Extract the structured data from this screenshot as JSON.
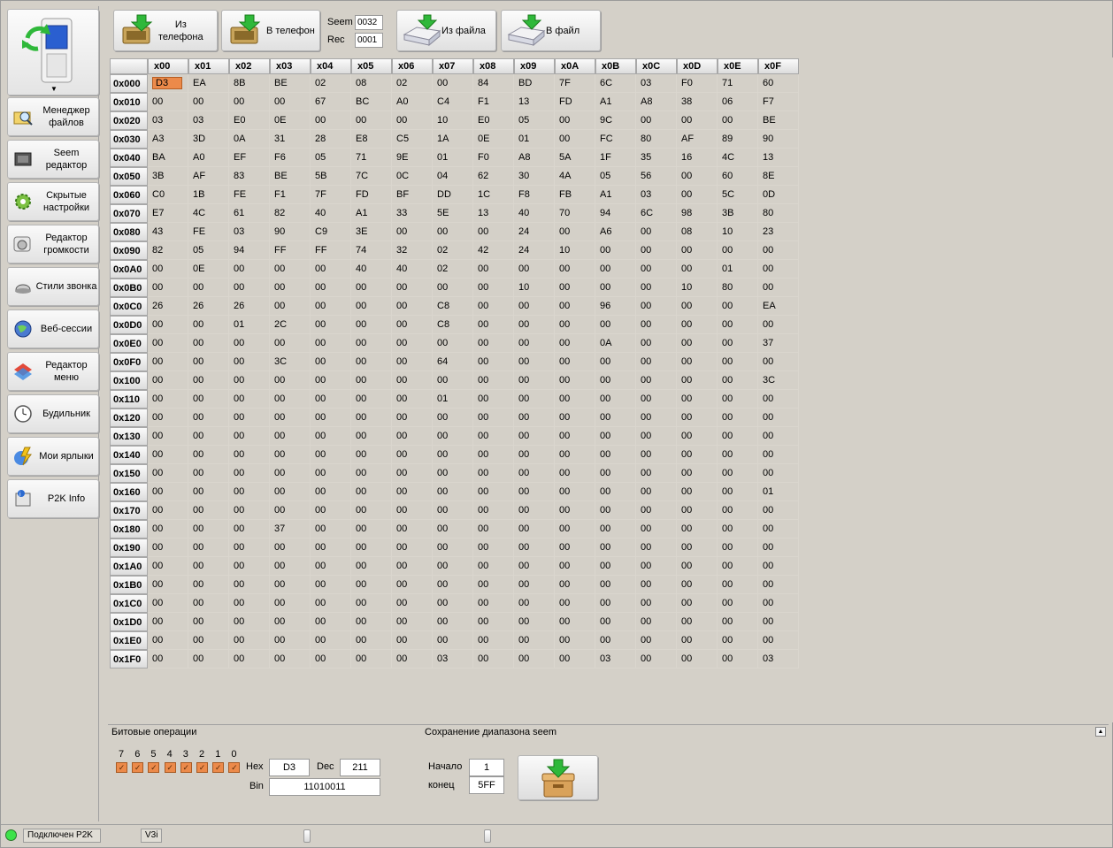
{
  "toolbar": {
    "from_phone": "Из\nтелефона",
    "to_phone": "В телефон",
    "seem_label": "Seem",
    "seem_value": "0032",
    "rec_label": "Rec",
    "rec_value": "0001",
    "from_file": "Из файла",
    "to_file": "В файл"
  },
  "sidebar": {
    "items": [
      {
        "label": "Менеджер\nфайлов",
        "icon": "folder-magnifier-icon"
      },
      {
        "label": "Seem\nредактор",
        "icon": "chip-icon"
      },
      {
        "label": "Скрытые\nнастройки",
        "icon": "gear-icon"
      },
      {
        "label": "Редактор\nгромкости",
        "icon": "speaker-icon"
      },
      {
        "label": "Стили звонка",
        "icon": "bell-icon"
      },
      {
        "label": "Веб-сессии",
        "icon": "globe-icon"
      },
      {
        "label": "Редактор\nменю",
        "icon": "menu-icon"
      },
      {
        "label": "Будильник",
        "icon": "clock-icon"
      },
      {
        "label": "Мои ярлыки",
        "icon": "shortcut-icon"
      },
      {
        "label": "P2K Info",
        "icon": "info-icon"
      }
    ]
  },
  "hex": {
    "columns": [
      "x00",
      "x01",
      "x02",
      "x03",
      "x04",
      "x05",
      "x06",
      "x07",
      "x08",
      "x09",
      "x0A",
      "x0B",
      "x0C",
      "x0D",
      "x0E",
      "x0F"
    ],
    "selected": {
      "row": 0,
      "col": 0
    },
    "rows": [
      {
        "addr": "0x000",
        "cells": [
          "D3",
          "EA",
          "8B",
          "BE",
          "02",
          "08",
          "02",
          "00",
          "84",
          "BD",
          "7F",
          "6C",
          "03",
          "F0",
          "71",
          "60"
        ]
      },
      {
        "addr": "0x010",
        "cells": [
          "00",
          "00",
          "00",
          "00",
          "67",
          "BC",
          "A0",
          "C4",
          "F1",
          "13",
          "FD",
          "A1",
          "A8",
          "38",
          "06",
          "F7"
        ]
      },
      {
        "addr": "0x020",
        "cells": [
          "03",
          "03",
          "E0",
          "0E",
          "00",
          "00",
          "00",
          "10",
          "E0",
          "05",
          "00",
          "9C",
          "00",
          "00",
          "00",
          "BE"
        ]
      },
      {
        "addr": "0x030",
        "cells": [
          "A3",
          "3D",
          "0A",
          "31",
          "28",
          "E8",
          "C5",
          "1A",
          "0E",
          "01",
          "00",
          "FC",
          "80",
          "AF",
          "89",
          "90"
        ]
      },
      {
        "addr": "0x040",
        "cells": [
          "BA",
          "A0",
          "EF",
          "F6",
          "05",
          "71",
          "9E",
          "01",
          "F0",
          "A8",
          "5A",
          "1F",
          "35",
          "16",
          "4C",
          "13"
        ]
      },
      {
        "addr": "0x050",
        "cells": [
          "3B",
          "AF",
          "83",
          "BE",
          "5B",
          "7C",
          "0C",
          "04",
          "62",
          "30",
          "4A",
          "05",
          "56",
          "00",
          "60",
          "8E"
        ]
      },
      {
        "addr": "0x060",
        "cells": [
          "C0",
          "1B",
          "FE",
          "F1",
          "7F",
          "FD",
          "BF",
          "DD",
          "1C",
          "F8",
          "FB",
          "A1",
          "03",
          "00",
          "5C",
          "0D"
        ]
      },
      {
        "addr": "0x070",
        "cells": [
          "E7",
          "4C",
          "61",
          "82",
          "40",
          "A1",
          "33",
          "5E",
          "13",
          "40",
          "70",
          "94",
          "6C",
          "98",
          "3B",
          "80"
        ]
      },
      {
        "addr": "0x080",
        "cells": [
          "43",
          "FE",
          "03",
          "90",
          "C9",
          "3E",
          "00",
          "00",
          "00",
          "24",
          "00",
          "A6",
          "00",
          "08",
          "10",
          "23"
        ]
      },
      {
        "addr": "0x090",
        "cells": [
          "82",
          "05",
          "94",
          "FF",
          "FF",
          "74",
          "32",
          "02",
          "42",
          "24",
          "10",
          "00",
          "00",
          "00",
          "00",
          "00"
        ]
      },
      {
        "addr": "0x0A0",
        "cells": [
          "00",
          "0E",
          "00",
          "00",
          "00",
          "40",
          "40",
          "02",
          "00",
          "00",
          "00",
          "00",
          "00",
          "00",
          "01",
          "00"
        ]
      },
      {
        "addr": "0x0B0",
        "cells": [
          "00",
          "00",
          "00",
          "00",
          "00",
          "00",
          "00",
          "00",
          "00",
          "10",
          "00",
          "00",
          "00",
          "10",
          "80",
          "00"
        ]
      },
      {
        "addr": "0x0C0",
        "cells": [
          "26",
          "26",
          "26",
          "00",
          "00",
          "00",
          "00",
          "C8",
          "00",
          "00",
          "00",
          "96",
          "00",
          "00",
          "00",
          "EA"
        ]
      },
      {
        "addr": "0x0D0",
        "cells": [
          "00",
          "00",
          "01",
          "2C",
          "00",
          "00",
          "00",
          "C8",
          "00",
          "00",
          "00",
          "00",
          "00",
          "00",
          "00",
          "00"
        ]
      },
      {
        "addr": "0x0E0",
        "cells": [
          "00",
          "00",
          "00",
          "00",
          "00",
          "00",
          "00",
          "00",
          "00",
          "00",
          "00",
          "0A",
          "00",
          "00",
          "00",
          "37"
        ]
      },
      {
        "addr": "0x0F0",
        "cells": [
          "00",
          "00",
          "00",
          "3C",
          "00",
          "00",
          "00",
          "64",
          "00",
          "00",
          "00",
          "00",
          "00",
          "00",
          "00",
          "00"
        ]
      },
      {
        "addr": "0x100",
        "cells": [
          "00",
          "00",
          "00",
          "00",
          "00",
          "00",
          "00",
          "00",
          "00",
          "00",
          "00",
          "00",
          "00",
          "00",
          "00",
          "3C"
        ]
      },
      {
        "addr": "0x110",
        "cells": [
          "00",
          "00",
          "00",
          "00",
          "00",
          "00",
          "00",
          "01",
          "00",
          "00",
          "00",
          "00",
          "00",
          "00",
          "00",
          "00"
        ]
      },
      {
        "addr": "0x120",
        "cells": [
          "00",
          "00",
          "00",
          "00",
          "00",
          "00",
          "00",
          "00",
          "00",
          "00",
          "00",
          "00",
          "00",
          "00",
          "00",
          "00"
        ]
      },
      {
        "addr": "0x130",
        "cells": [
          "00",
          "00",
          "00",
          "00",
          "00",
          "00",
          "00",
          "00",
          "00",
          "00",
          "00",
          "00",
          "00",
          "00",
          "00",
          "00"
        ]
      },
      {
        "addr": "0x140",
        "cells": [
          "00",
          "00",
          "00",
          "00",
          "00",
          "00",
          "00",
          "00",
          "00",
          "00",
          "00",
          "00",
          "00",
          "00",
          "00",
          "00"
        ]
      },
      {
        "addr": "0x150",
        "cells": [
          "00",
          "00",
          "00",
          "00",
          "00",
          "00",
          "00",
          "00",
          "00",
          "00",
          "00",
          "00",
          "00",
          "00",
          "00",
          "00"
        ]
      },
      {
        "addr": "0x160",
        "cells": [
          "00",
          "00",
          "00",
          "00",
          "00",
          "00",
          "00",
          "00",
          "00",
          "00",
          "00",
          "00",
          "00",
          "00",
          "00",
          "01"
        ]
      },
      {
        "addr": "0x170",
        "cells": [
          "00",
          "00",
          "00",
          "00",
          "00",
          "00",
          "00",
          "00",
          "00",
          "00",
          "00",
          "00",
          "00",
          "00",
          "00",
          "00"
        ]
      },
      {
        "addr": "0x180",
        "cells": [
          "00",
          "00",
          "00",
          "37",
          "00",
          "00",
          "00",
          "00",
          "00",
          "00",
          "00",
          "00",
          "00",
          "00",
          "00",
          "00"
        ]
      },
      {
        "addr": "0x190",
        "cells": [
          "00",
          "00",
          "00",
          "00",
          "00",
          "00",
          "00",
          "00",
          "00",
          "00",
          "00",
          "00",
          "00",
          "00",
          "00",
          "00"
        ]
      },
      {
        "addr": "0x1A0",
        "cells": [
          "00",
          "00",
          "00",
          "00",
          "00",
          "00",
          "00",
          "00",
          "00",
          "00",
          "00",
          "00",
          "00",
          "00",
          "00",
          "00"
        ]
      },
      {
        "addr": "0x1B0",
        "cells": [
          "00",
          "00",
          "00",
          "00",
          "00",
          "00",
          "00",
          "00",
          "00",
          "00",
          "00",
          "00",
          "00",
          "00",
          "00",
          "00"
        ]
      },
      {
        "addr": "0x1C0",
        "cells": [
          "00",
          "00",
          "00",
          "00",
          "00",
          "00",
          "00",
          "00",
          "00",
          "00",
          "00",
          "00",
          "00",
          "00",
          "00",
          "00"
        ]
      },
      {
        "addr": "0x1D0",
        "cells": [
          "00",
          "00",
          "00",
          "00",
          "00",
          "00",
          "00",
          "00",
          "00",
          "00",
          "00",
          "00",
          "00",
          "00",
          "00",
          "00"
        ]
      },
      {
        "addr": "0x1E0",
        "cells": [
          "00",
          "00",
          "00",
          "00",
          "00",
          "00",
          "00",
          "00",
          "00",
          "00",
          "00",
          "00",
          "00",
          "00",
          "00",
          "00"
        ]
      },
      {
        "addr": "0x1F0",
        "cells": [
          "00",
          "00",
          "00",
          "00",
          "00",
          "00",
          "00",
          "03",
          "00",
          "00",
          "00",
          "03",
          "00",
          "00",
          "00",
          "03"
        ]
      }
    ]
  },
  "bits": {
    "title": "Битовые операции",
    "labels": [
      "7",
      "6",
      "5",
      "4",
      "3",
      "2",
      "1",
      "0"
    ],
    "hex_label": "Hex",
    "hex_value": "D3",
    "dec_label": "Dec",
    "dec_value": "211",
    "bin_label": "Bin",
    "bin_value": "11010011"
  },
  "range": {
    "title": "Сохранение диапазона seem",
    "start_label": "Начало",
    "start_value": "1",
    "end_label": "конец",
    "end_value": "5FF"
  },
  "status": {
    "connection": "Подключен P2K",
    "model": "V3i"
  },
  "colors": {
    "selected_cell": "#ec8a4a",
    "connected_led": "#3ee24a",
    "accent_arrow": "#2fb83a"
  }
}
